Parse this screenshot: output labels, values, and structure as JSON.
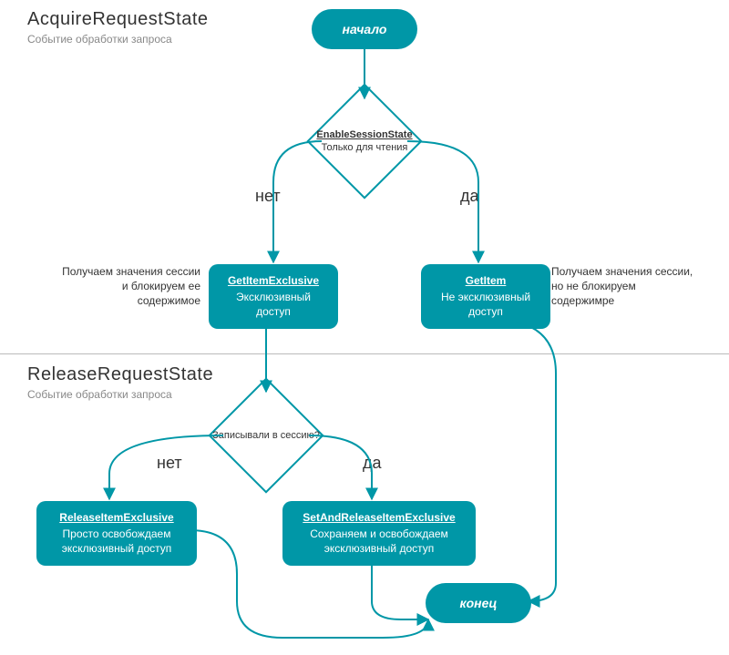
{
  "chart_data": {
    "type": "flowchart",
    "title": "AcquireRequestState / ReleaseRequestState",
    "nodes": [
      {
        "id": "start",
        "shape": "terminator",
        "label": "начало"
      },
      {
        "id": "dec1",
        "shape": "decision",
        "title": "EnableSessionState",
        "sub": "Только для чтения"
      },
      {
        "id": "gix",
        "shape": "process",
        "title": "GetItemExclusive",
        "sub": "Эксклюзивный доступ"
      },
      {
        "id": "gi",
        "shape": "process",
        "title": "GetItem",
        "sub": "Не эксклюзивный доступ"
      },
      {
        "id": "dec2",
        "shape": "decision",
        "sub": "Записывали в сессию?"
      },
      {
        "id": "rix",
        "shape": "process",
        "title": "ReleaseItemExclusive",
        "sub": "Просто освобождаем эксклюзивный доступ"
      },
      {
        "id": "srix",
        "shape": "process",
        "title": "SetAndReleaseItemExclusive",
        "sub": "Сохраняем и освобождаем эксклюзивный доступ"
      },
      {
        "id": "end",
        "shape": "terminator",
        "label": "конец"
      }
    ],
    "edges": [
      {
        "from": "start",
        "to": "dec1"
      },
      {
        "from": "dec1",
        "to": "gix",
        "label": "нет"
      },
      {
        "from": "dec1",
        "to": "gi",
        "label": "да"
      },
      {
        "from": "gix",
        "to": "dec2"
      },
      {
        "from": "dec2",
        "to": "rix",
        "label": "нет"
      },
      {
        "from": "dec2",
        "to": "srix",
        "label": "да"
      },
      {
        "from": "rix",
        "to": "end"
      },
      {
        "from": "srix",
        "to": "end"
      },
      {
        "from": "gi",
        "to": "end"
      }
    ]
  },
  "sections": {
    "acquire": {
      "title": "AcquireRequestState",
      "sub": "Событие обработки запроса"
    },
    "release": {
      "title": "ReleaseRequestState",
      "sub": "Событие обработки запроса"
    }
  },
  "nodes": {
    "start": "начало",
    "end": "конец",
    "dec1_title": "EnableSessionState",
    "dec1_sub": "Только для чтения",
    "dec2_sub": "Записывали в сессию?",
    "gix_title": "GetItemExclusive",
    "gix_sub": "Эксклюзивный\nдоступ",
    "gi_title": "GetItem",
    "gi_sub": "Не эксклюзивный\nдоступ",
    "rix_title": "ReleaseItemExclusive",
    "rix_sub": "Просто освобождаем\nэксклюзивный доступ",
    "srix_title": "SetAndReleaseItemExclusive",
    "srix_sub": "Сохраняем и освобождаем\nэксклюзивный доступ"
  },
  "labels": {
    "no": "нет",
    "yes": "да"
  },
  "notes": {
    "left": "Получаем значения сессии\nи блокируем ее\nсодержимое",
    "right": "Получаем значения сессии,\nно не блокируем\nсодержимре"
  }
}
